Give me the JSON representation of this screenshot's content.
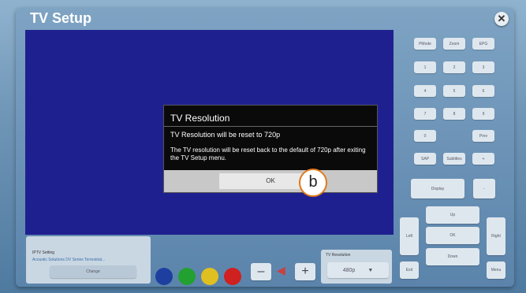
{
  "window": {
    "title": "TV Setup",
    "close_glyph": "✕"
  },
  "dialog": {
    "title": "TV Resolution",
    "subtitle": "TV Resolution will be reset to 720p",
    "body": "The TV resolution will be reset back to the default of 720p after exiting the TV Setup menu.",
    "ok_label": "OK"
  },
  "callout": {
    "label": "b"
  },
  "remote": {
    "top_row": [
      "PMode",
      "Zoom",
      "EPG"
    ],
    "row2": [
      "1",
      "2",
      "3"
    ],
    "row3": [
      "4",
      "5",
      "6"
    ],
    "row4": [
      "7",
      "8",
      "9"
    ],
    "row5_left": "0",
    "row5_right": "Prev",
    "row6": [
      "SAP",
      "Subtitles",
      "+"
    ],
    "display": "Display",
    "display_right": "-",
    "nav": {
      "up": "Up",
      "left": "Left",
      "ok": "OK",
      "right": "Right",
      "down": "Down",
      "exit": "Exit",
      "menu": "Menu"
    }
  },
  "iptv": {
    "label": "IPTV Setting",
    "value": "Acoustic Solutions DV Series Terrestrial...",
    "change": "Change"
  },
  "tv_resolution": {
    "label": "TV Resolution",
    "value": "480p"
  },
  "colors": {
    "red": "#d02020",
    "blue": "#1f3fa0",
    "green": "#22a030",
    "yellow": "#e0c020"
  }
}
